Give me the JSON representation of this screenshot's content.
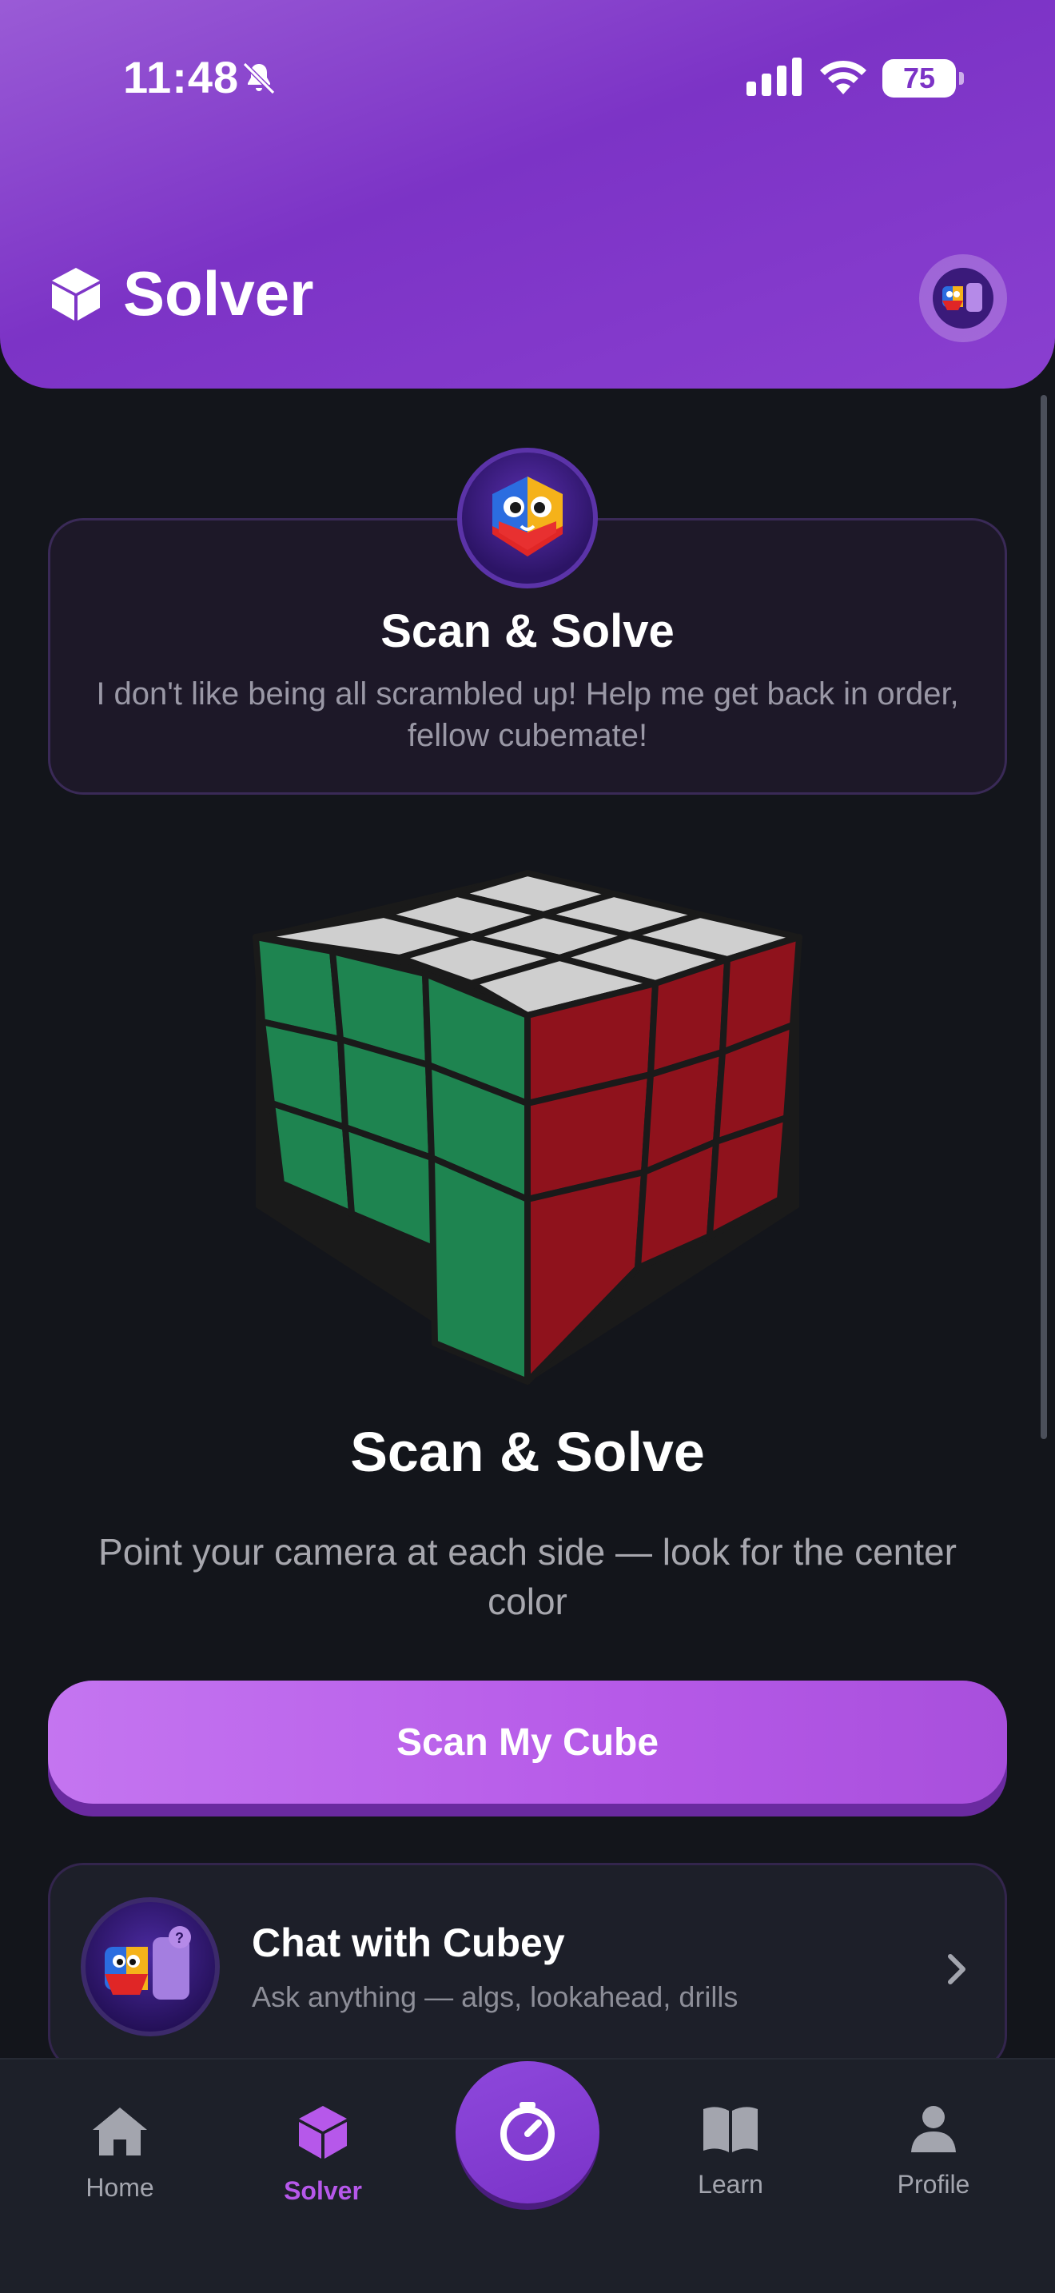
{
  "status_bar": {
    "time": "11:48",
    "battery": "75"
  },
  "header": {
    "title": "Solver"
  },
  "mascot_card": {
    "title": "Scan & Solve",
    "message": "I don't like being all scrambled up! Help me get back in order, fellow cubemate!"
  },
  "main": {
    "title": "Scan & Solve",
    "subtitle": "Point your camera at each side — look for the center color",
    "scan_button": "Scan My Cube"
  },
  "chat_card": {
    "title": "Chat with Cubey",
    "subtitle": "Ask anything — algs, lookahead, drills"
  },
  "nav": {
    "items": [
      {
        "label": "Home",
        "icon": "home-icon"
      },
      {
        "label": "Solver",
        "icon": "cube-icon"
      },
      {
        "label": "",
        "icon": "timer-icon"
      },
      {
        "label": "Learn",
        "icon": "book-icon"
      },
      {
        "label": "Profile",
        "icon": "person-icon"
      }
    ]
  },
  "colors": {
    "accent": "#b658ea",
    "header": "#7c33c6",
    "background": "#13151b",
    "cube_top": "#cfcfcf",
    "cube_left": "#1e8450",
    "cube_right": "#8f121c"
  }
}
